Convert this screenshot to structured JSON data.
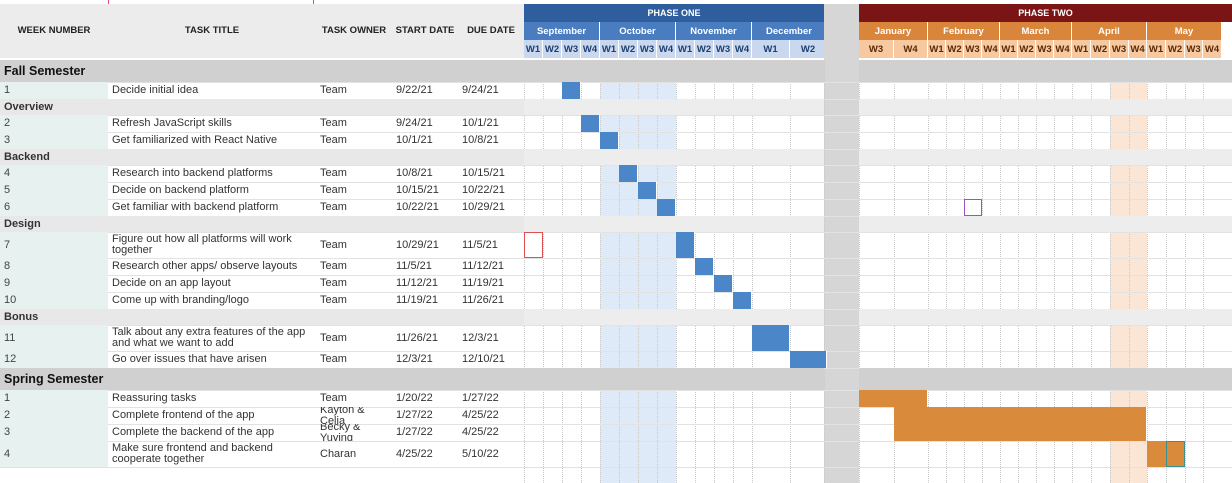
{
  "columns": {
    "week_number": "WEEK NUMBER",
    "task_title": "TASK TITLE",
    "task_owner": "TASK OWNER",
    "start_date": "START DATE",
    "due_date": "DUE DATE"
  },
  "phases": [
    {
      "label": "PHASE ONE",
      "color": "#2f5e9e"
    },
    {
      "label": "PHASE TWO",
      "color": "#7b1414"
    }
  ],
  "months_p1": [
    "September",
    "October",
    "November",
    "December"
  ],
  "months_p2": [
    "January",
    "February",
    "March",
    "April",
    "May"
  ],
  "weeks_p1": [
    "W1",
    "W2",
    "W3",
    "W4",
    "W1",
    "W2",
    "W3",
    "W4",
    "W1",
    "W2",
    "W3",
    "W4",
    "W1",
    "W2"
  ],
  "weeks_p2": [
    "W3",
    "W4",
    "W1",
    "W2",
    "W3",
    "W4",
    "W1",
    "W2",
    "W3",
    "W4",
    "W1",
    "W2",
    "W3",
    "W4",
    "W1",
    "W2",
    "W3",
    "W4"
  ],
  "colors": {
    "bar_blue": "#4a86c8",
    "bar_orange": "#d98a3a",
    "month_blue": "#4a7cc0",
    "week_blue": "#c9d8ee",
    "month_orange": "#d9863c",
    "week_orange": "#f6c9a0",
    "section_gray": "#d0d0d0",
    "shade_blue": "#deeaf8",
    "shade_peach": "#fbe5d4"
  },
  "rows": [
    {
      "type": "section",
      "label": "Fall Semester"
    },
    {
      "type": "task",
      "num": "1",
      "title": "Decide initial idea",
      "owner": "Team",
      "start": "9/22/21",
      "due": "9/24/21"
    },
    {
      "type": "sub",
      "label": "Overview"
    },
    {
      "type": "task",
      "num": "2",
      "title": "Refresh JavaScript skills",
      "owner": "Team",
      "start": "9/24/21",
      "due": "10/1/21"
    },
    {
      "type": "task",
      "num": "3",
      "title": "Get familiarized with React Native",
      "owner": "Team",
      "start": "10/1/21",
      "due": "10/8/21"
    },
    {
      "type": "sub",
      "label": "Backend"
    },
    {
      "type": "task",
      "num": "4",
      "title": "Research into backend platforms",
      "owner": "Team",
      "start": "10/8/21",
      "due": "10/15/21"
    },
    {
      "type": "task",
      "num": "5",
      "title": "Decide on backend platform",
      "owner": "Team",
      "start": "10/15/21",
      "due": "10/22/21"
    },
    {
      "type": "task",
      "num": "6",
      "title": "Get familiar with backend platform",
      "owner": "Team",
      "start": "10/22/21",
      "due": "10/29/21"
    },
    {
      "type": "sub",
      "label": "Design"
    },
    {
      "type": "task",
      "num": "7",
      "title": "Figure out how all platforms will work together",
      "owner": "Team",
      "start": "10/29/21",
      "due": "11/5/21"
    },
    {
      "type": "task",
      "num": "8",
      "title": "Research other apps/ observe layouts",
      "owner": "Team",
      "start": "11/5/21",
      "due": "11/12/21"
    },
    {
      "type": "task",
      "num": "9",
      "title": "Decide on an app layout",
      "owner": "Team",
      "start": "11/12/21",
      "due": "11/19/21"
    },
    {
      "type": "task",
      "num": "10",
      "title": "Come up with branding/logo",
      "owner": "Team",
      "start": "11/19/21",
      "due": "11/26/21"
    },
    {
      "type": "sub",
      "label": "Bonus"
    },
    {
      "type": "task",
      "num": "11",
      "title": "Talk about any extra features of the app and what we want to add",
      "owner": "Team",
      "start": "11/26/21",
      "due": "12/3/21"
    },
    {
      "type": "task",
      "num": "12",
      "title": "Go over issues that have arisen",
      "owner": "Team",
      "start": "12/3/21",
      "due": "12/10/21"
    },
    {
      "type": "section",
      "label": "Spring Semester"
    },
    {
      "type": "task",
      "num": "1",
      "title": "Reassuring tasks",
      "owner": "Team",
      "start": "1/20/22",
      "due": "1/27/22"
    },
    {
      "type": "task",
      "num": "2",
      "title": "Complete frontend of the app",
      "owner": "Kayton & Celia",
      "start": "1/27/22",
      "due": "4/25/22"
    },
    {
      "type": "task",
      "num": "3",
      "title": "Complete the backend of the app",
      "owner": "Becky & Yuying",
      "start": "1/27/22",
      "due": "4/25/22"
    },
    {
      "type": "task",
      "num": "4",
      "title": "Make sure frontend and backend cooperate together",
      "owner": "Charan",
      "start": "4/25/22",
      "due": "5/10/22"
    }
  ]
}
